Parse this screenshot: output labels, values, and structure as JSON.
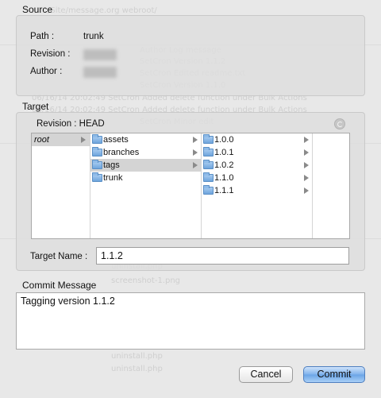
{
  "source": {
    "section_label": "Source",
    "path_label": "Path :",
    "path_value": "trunk",
    "revision_label": "Revision :",
    "revision_value": "(redacted)",
    "author_label": "Author :",
    "author_value": "(redacted)"
  },
  "target": {
    "section_label": "Target",
    "revision_text": "Revision : HEAD",
    "browser": {
      "col1": [
        {
          "label": "root",
          "selected": true,
          "has_children": true
        }
      ],
      "col2": [
        {
          "label": "assets",
          "selected": false,
          "has_children": true
        },
        {
          "label": "branches",
          "selected": false,
          "has_children": true
        },
        {
          "label": "tags",
          "selected": true,
          "has_children": true
        },
        {
          "label": "trunk",
          "selected": false,
          "has_children": false
        }
      ],
      "col3": [
        {
          "label": "1.0.0",
          "has_children": true
        },
        {
          "label": "1.0.1",
          "has_children": true
        },
        {
          "label": "1.0.2",
          "has_children": true
        },
        {
          "label": "1.1.0",
          "has_children": true
        },
        {
          "label": "1.1.1",
          "has_children": true
        }
      ]
    },
    "target_name_label": "Target Name :",
    "target_name_value": "1.1.2"
  },
  "commit": {
    "section_label": "Commit Message",
    "message": "Tagging  version 1.1.2"
  },
  "buttons": {
    "cancel": "Cancel",
    "commit": "Commit"
  },
  "colors": {
    "accent": "#6aa4e6",
    "selection": "#d4d4d4"
  }
}
